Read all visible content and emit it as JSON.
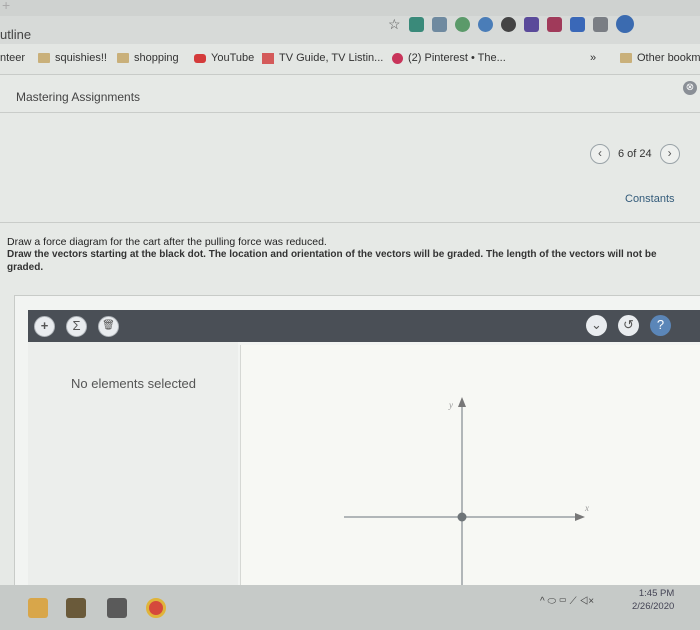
{
  "browser": {
    "tab_title_partial": "utline",
    "bookmarks": [
      {
        "label": "nteer"
      },
      {
        "label": "squishies!!"
      },
      {
        "label": "shopping"
      },
      {
        "label": "YouTube"
      },
      {
        "label": "TV Guide, TV Listin..."
      },
      {
        "label": "(2) Pinterest • The..."
      }
    ],
    "overflow_label": "»",
    "other_bookmarks": "Other bookma"
  },
  "header": {
    "title": "Mastering Assignments",
    "close_icon": "⊗"
  },
  "pager": {
    "prev": "‹",
    "position": "6 of 24",
    "next": "›"
  },
  "constants_link": "Constants",
  "question": {
    "line1": "Draw a force diagram for the cart after the pulling force was reduced.",
    "line2": "Draw the vectors starting at the black dot. The location and orientation of the vectors will be graded. The length of the vectors will not be graded."
  },
  "tool": {
    "add_icon": "+",
    "sum_icon": "Σ",
    "trash_icon": "🗑",
    "dropdown_icon": "⌄",
    "reset_icon": "↺",
    "help_icon": "?",
    "status": "No elements selected",
    "axis_y": "y",
    "axis_x": "x"
  },
  "taskbar": {
    "time": "1:45 PM",
    "date": "2/26/2020",
    "tray_icons": "^ ⬭ ▭ ⟋ ◁×"
  },
  "colors": {
    "toolbar": "#4a4f56",
    "link": "#335b7a",
    "help_blue": "#5b86b8"
  }
}
